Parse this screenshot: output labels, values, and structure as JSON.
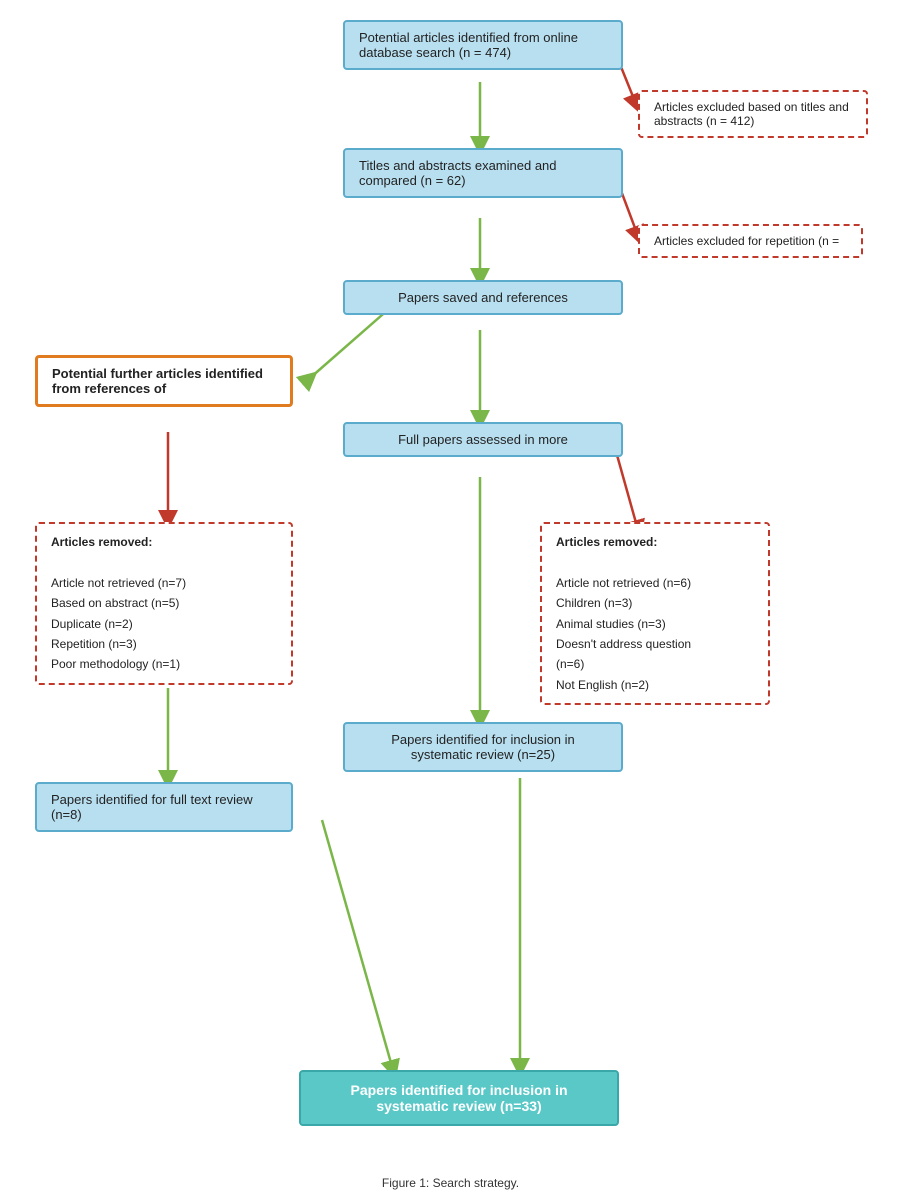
{
  "boxes": {
    "box1": {
      "label": "Potential articles identified from online\ndatabase search (n = 474)",
      "type": "blue"
    },
    "box2": {
      "label": "Titles and abstracts examined and\ncompared   (n = 62)",
      "type": "blue"
    },
    "box3": {
      "label": "Papers saved and references",
      "type": "blue"
    },
    "box4": {
      "label": "Full papers assessed in more",
      "type": "blue"
    },
    "box5": {
      "label": "Papers identified for inclusion in\nsystematic review (n=25)",
      "type": "blue"
    },
    "box6": {
      "label": "Papers identified for full\ntext review (n=8)",
      "type": "blue"
    },
    "box7": {
      "label": "Papers identified for inclusion in\nsystematic review (n=33)",
      "type": "teal"
    },
    "box_orange": {
      "label": "Potential further articles\nidentified from references of",
      "type": "orange"
    },
    "box_excl1": {
      "label": "Articles excluded based on titles and\nabstracts (n = 412)",
      "type": "red-dashed"
    },
    "box_excl2": {
      "label": "Articles excluded for repetition (n =",
      "type": "red-dashed"
    },
    "box_removed1": {
      "label": "Articles removed:\n\nArticle not retrieved (n=7)\nBased on abstract (n=5)\nDuplicate (n=2)\nRepetition (n=3)\nPoor methodology (n=1)",
      "type": "red-dashed"
    },
    "box_removed2": {
      "label": "Articles removed:\n\nArticle not retrieved (n=6)\nChildren (n=3)\nAnimal studies (n=3)\nDoesn’t address question\n(n=6)\nNot English (n=2)",
      "type": "red-dashed"
    }
  },
  "caption": "Figure 1: Search strategy."
}
